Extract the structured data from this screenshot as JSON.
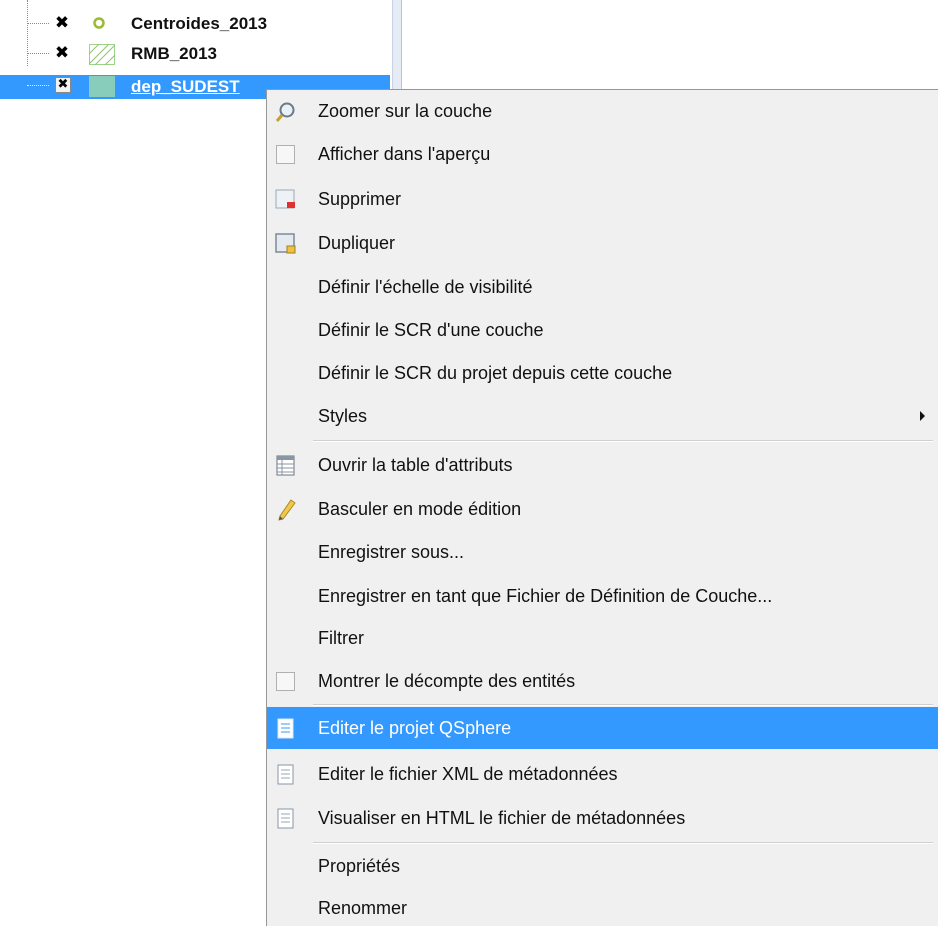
{
  "layer_tree": {
    "layers": [
      {
        "name": "Centroides_2013",
        "checked_glyph": "✖",
        "symbol": "point-symbol-icon"
      },
      {
        "name": "RMB_2013",
        "checked_glyph": "✖",
        "symbol": "hatched-polygon-icon"
      },
      {
        "name": "dep_SUDEST",
        "checked_glyph": "✖",
        "symbol": "filled-polygon-icon",
        "selected": true
      }
    ]
  },
  "context_menu": {
    "items": [
      {
        "label": "Zoomer sur la couche",
        "icon": "zoom-layer-icon"
      },
      {
        "label": "Afficher dans l'aperçu",
        "icon": "checkbox-icon"
      },
      {
        "label": "Supprimer",
        "icon": "remove-layer-icon"
      },
      {
        "label": "Dupliquer",
        "icon": "duplicate-layer-icon"
      },
      {
        "label": "Définir l'échelle de visibilité"
      },
      {
        "label": "Définir le SCR d'une couche"
      },
      {
        "label": "Définir le SCR du projet depuis cette couche"
      },
      {
        "label": "Styles",
        "submenu": true
      },
      {
        "label": "Ouvrir la table d'attributs",
        "icon": "attribute-table-icon"
      },
      {
        "label": "Basculer en mode édition",
        "icon": "pencil-icon"
      },
      {
        "label": "Enregistrer sous..."
      },
      {
        "label": "Enregistrer en tant que Fichier de Définition de Couche..."
      },
      {
        "label": "Filtrer"
      },
      {
        "label": "Montrer le décompte des entités",
        "icon": "checkbox-icon"
      },
      {
        "label": "Editer le projet QSphere",
        "icon": "document-icon",
        "highlighted": true
      },
      {
        "label": "Editer le fichier XML de métadonnées",
        "icon": "document-icon"
      },
      {
        "label": "Visualiser en HTML le fichier de métadonnées",
        "icon": "document-icon"
      },
      {
        "label": "Propriétés"
      },
      {
        "label": "Renommer"
      }
    ]
  },
  "colors": {
    "selection": "#3399ff",
    "menu_background": "#f0f0f0",
    "menu_text": "#111111",
    "point_symbol": "#99bb33",
    "polygon_fill": "#88ccbb"
  }
}
